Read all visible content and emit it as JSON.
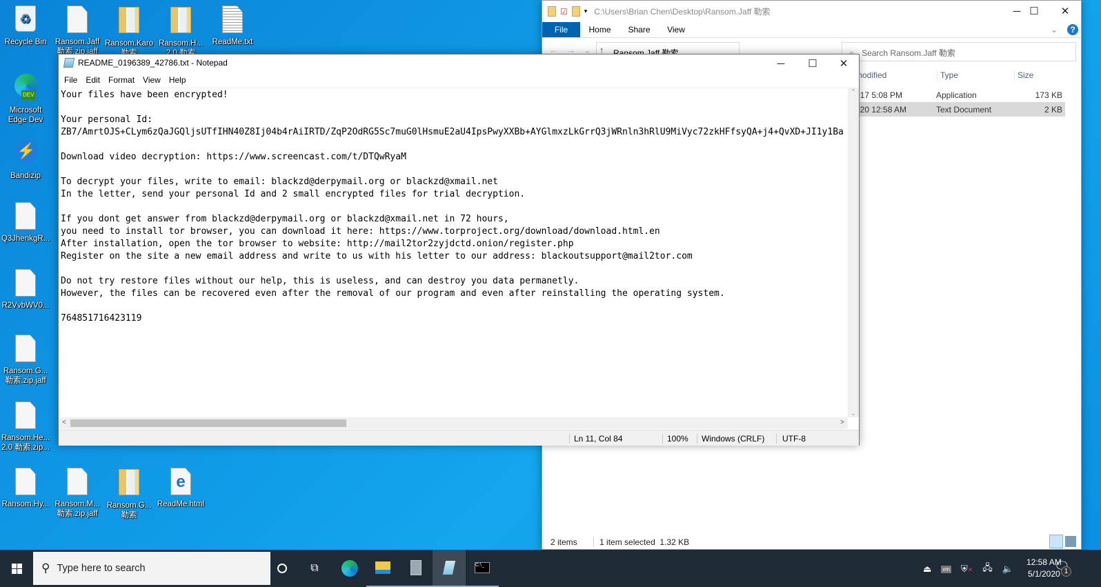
{
  "desktop": {
    "icons": [
      {
        "label": "Recycle Bin",
        "type": "recycle"
      },
      {
        "label": "Ransom.Jaff 勒索.zip.jaff",
        "type": "file"
      },
      {
        "label": "Ransom.Karo 勒索",
        "type": "folder"
      },
      {
        "label": "Ransom.H... 2.0 勒索",
        "type": "folder"
      },
      {
        "label": "ReadMe.txt",
        "type": "txt"
      },
      {
        "label": "Microsoft Edge Dev",
        "type": "edge"
      },
      {
        "label": "Bandizip",
        "type": "bandizip"
      },
      {
        "label": "Q3JhenkgR...",
        "type": "file"
      },
      {
        "label": "R2VvbWV0...",
        "type": "file"
      },
      {
        "label": "Ransom.G... 勒索.zip.jaff",
        "type": "file"
      },
      {
        "label": "Ransom.He... 2.0 勒索.zip...",
        "type": "file"
      },
      {
        "label": "Ransom.Hy...",
        "type": "file"
      },
      {
        "label": "Ransom.M... 勒索.zip.jaff",
        "type": "file"
      },
      {
        "label": "Ransom.G... 勒索",
        "type": "folder"
      },
      {
        "label": "ReadMe.html",
        "type": "html"
      }
    ]
  },
  "explorer": {
    "title": "C:\\Users\\Brian Chen\\Desktop\\Ransom.Jaff 勒索",
    "tabs": [
      "File",
      "Home",
      "Share",
      "View"
    ],
    "address": "Ransom.Jaff 勒索",
    "search_placeholder": "Search Ransom.Jaff 勒索",
    "columns": [
      "modified",
      "Type",
      "Size"
    ],
    "rows": [
      {
        "modified": "017 5:08 PM",
        "type": "Application",
        "size": "173 KB",
        "selected": false
      },
      {
        "modified": "020 12:58 AM",
        "type": "Text Document",
        "size": "2 KB",
        "selected": true
      }
    ],
    "status": {
      "items": "2 items",
      "selected": "1 item selected  1.32 KB"
    }
  },
  "notepad": {
    "title": "README_0196389_42786.txt - Notepad",
    "menu": [
      "File",
      "Edit",
      "Format",
      "View",
      "Help"
    ],
    "lines": [
      "Your files have been encrypted!",
      "",
      "Your personal Id:",
      "ZB7/AmrtOJS+CLym6zQaJGQljsUTfIHN40Z8Ij04b4rAiIRTD/ZqP2OdRG5Sc7muG0lHsmuE2aU4IpsPwyXXBb+AYGlmxzLkGrrQ3jWRnln3hRlU9MiVyc72zkHFfsyQA+j4+QvXD+JI1y1Ba",
      "",
      "Download video decryption: https://www.screencast.com/t/DTQwRyaM",
      "",
      "To decrypt your files, write to email: blackzd@derpymail.org or blackzd@xmail.net",
      "In the letter, send your personal Id and 2 small encrypted files for trial decryption.",
      "",
      "If you dont get answer from blackzd@derpymail.org or blackzd@xmail.net in 72 hours,",
      "you need to install tor browser, you can download it here: https://www.torproject.org/download/download.html.en",
      "After installation, open the tor browser to website: http://mail2tor2zyjdctd.onion/register.php",
      "Register on the site a new email address and write to us with his letter to our address: blackoutsupport@mail2tor.com",
      "",
      "Do not try restore files without our help, this is useless, and can destroy you data permanetly.",
      "However, the files can be recovered even after the removal of our program and even after reinstalling the operating system.",
      "",
      "764851716423119"
    ],
    "status": {
      "position": "Ln 11, Col 84",
      "zoom": "100%",
      "eol": "Windows (CRLF)",
      "encoding": "UTF-8"
    }
  },
  "taskbar": {
    "search_placeholder": "Type here to search",
    "time": "12:58 AM",
    "date": "5/1/2020",
    "notifications": "1",
    "apps": [
      "cortana",
      "task-view",
      "edge-dev",
      "file-explorer",
      "bandizip",
      "notepad",
      "cmd"
    ]
  },
  "colors": {
    "accent": "#0063b1",
    "taskbar": "#1e2a35",
    "selected_row": "#d9d9d9"
  }
}
